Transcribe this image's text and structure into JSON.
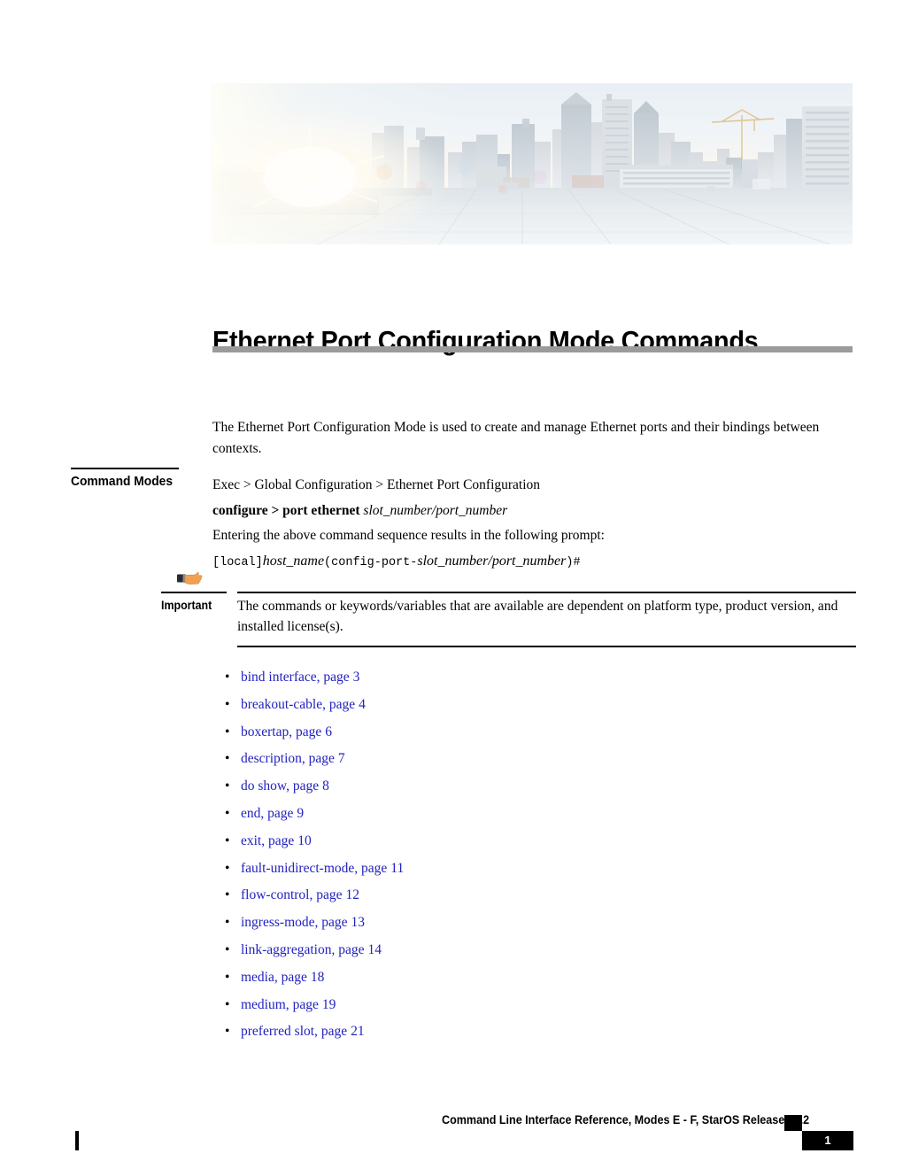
{
  "banner": {
    "alt": "city-skyline-banner",
    "icon": "cityscape-sunrise-banner-image"
  },
  "header": {
    "title": "Ethernet Port Configuration Mode Commands"
  },
  "intro": {
    "paragraph": "The Ethernet Port Configuration Mode is used to create and manage Ethernet ports and their bindings between contexts."
  },
  "command_modes": {
    "label": "Command Modes",
    "path": "Exec > Global Configuration > Ethernet Port Configuration",
    "syntax_bold": "configure > port ethernet",
    "syntax_var": "slot_number/port_number",
    "note": "Entering the above command sequence results in the following prompt:",
    "prompt": {
      "local": "[local]",
      "host": "host_name",
      "open": "(config-port-",
      "var": "slot_number/port_number",
      "close": ")#"
    }
  },
  "callout": {
    "icon": "pointing-hand-icon",
    "label": "Important",
    "text": "The commands or keywords/variables that are available are dependent on platform type, product version, and installed license(s)."
  },
  "links": {
    "bullet": "•",
    "page_word": "page",
    "items": [
      {
        "label": "bind interface,",
        "page": "3"
      },
      {
        "label": "breakout-cable,",
        "page": "4"
      },
      {
        "label": "boxertap,",
        "page": "6"
      },
      {
        "label": "description,",
        "page": "7"
      },
      {
        "label": "do show,",
        "page": "8"
      },
      {
        "label": "end,",
        "page": "9"
      },
      {
        "label": "exit,",
        "page": "10"
      },
      {
        "label": "fault-unidirect-mode,",
        "page": "11"
      },
      {
        "label": "flow-control,",
        "page": "12"
      },
      {
        "label": "ingress-mode,",
        "page": "13"
      },
      {
        "label": "link-aggregation,",
        "page": "14"
      },
      {
        "label": "media,",
        "page": "18"
      },
      {
        "label": "medium,",
        "page": "19"
      },
      {
        "label": "preferred slot,",
        "page": "21"
      }
    ]
  },
  "footer": {
    "title": "Command Line Interface Reference, Modes E - F, StarOS Release 21.2",
    "page_number": "1"
  },
  "colors": {
    "link": "#2222c0",
    "title_rule": "#9b9b9b",
    "callout_icon": "#f0a050",
    "text": "#000000"
  }
}
